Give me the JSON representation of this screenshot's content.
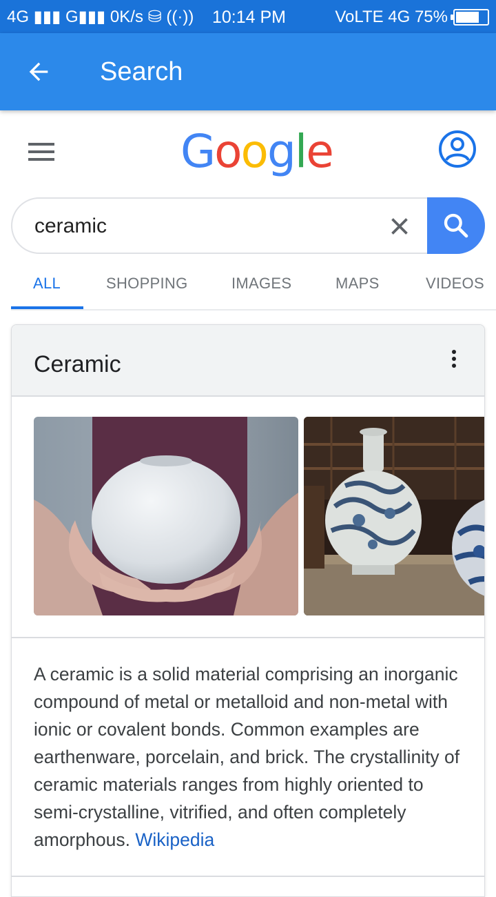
{
  "status_bar": {
    "left": "4G ▮▮▮ G▮▮▮ 0K/s ⛁ ((·))",
    "time": "10:14 PM",
    "right": "VoLTE 4G 75%",
    "battery_level": 0.75
  },
  "app_bar": {
    "title": "Search"
  },
  "google": {
    "logo_letters": [
      "G",
      "o",
      "o",
      "g",
      "l",
      "e"
    ],
    "logo_colors": [
      "#4285f4",
      "#ea4335",
      "#fbbc05",
      "#4285f4",
      "#34a853",
      "#ea4335"
    ]
  },
  "search": {
    "query": "ceramic"
  },
  "tabs": [
    {
      "label": "ALL",
      "active": true
    },
    {
      "label": "SHOPPING",
      "active": false
    },
    {
      "label": "IMAGES",
      "active": false
    },
    {
      "label": "MAPS",
      "active": false
    },
    {
      "label": "VIDEOS",
      "active": false
    }
  ],
  "card": {
    "title": "Ceramic",
    "description": "A ceramic is a solid material comprising an inorganic compound of metal or metalloid and non-metal with ionic or covalent bonds. Common examples are earthenware, porcelain, and brick. The crystallinity of ceramic materials ranges from highly oriented to semi-crystalline, vitrified, and often completely amorphous.",
    "source_link": "Wikipedia"
  },
  "colors": {
    "status_bar": "#1a73d9",
    "app_bar": "#2c89ea",
    "accent": "#1a73e8",
    "search_button": "#4285f4"
  }
}
